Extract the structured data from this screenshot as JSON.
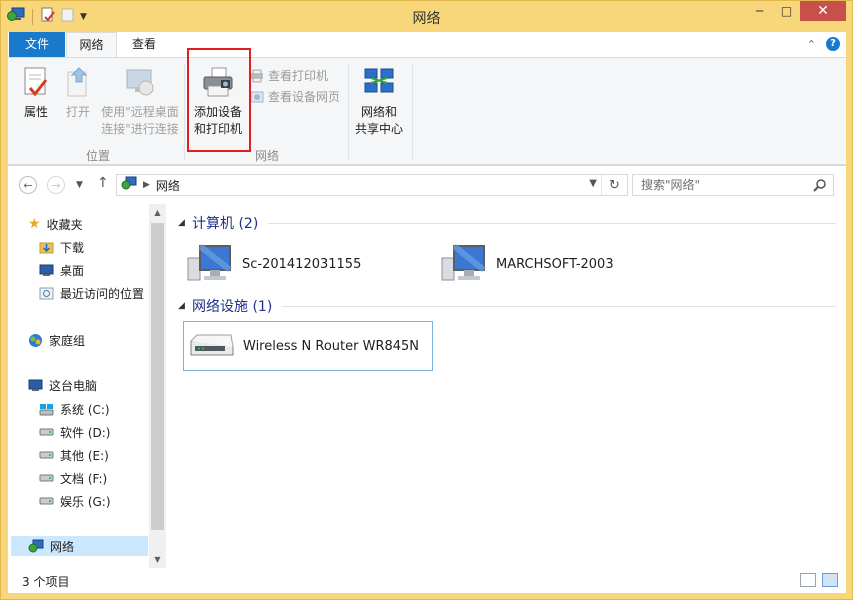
{
  "window": {
    "title": "网络",
    "minimize_glyph": "─",
    "maximize_glyph": "□",
    "close_glyph": "✕"
  },
  "ribbon": {
    "tabs": [
      {
        "label": "文件"
      },
      {
        "label": "网络"
      },
      {
        "label": "查看"
      }
    ],
    "location_group": {
      "label": "位置",
      "properties": "属性",
      "open": "打开",
      "remote_line1": "使用\"远程桌面",
      "remote_line2": "连接\"进行连接"
    },
    "network_group": {
      "label": "网络",
      "add_devices_line1": "添加设备",
      "add_devices_line2": "和打印机",
      "view_printers": "查看打印机",
      "view_device_webpage": "查看设备网页",
      "sharing_center_line1": "网络和",
      "sharing_center_line2": "共享中心"
    }
  },
  "address": {
    "path": "网络",
    "search_placeholder": "搜索\"网络\""
  },
  "nav_pane": {
    "favorites": "收藏夹",
    "downloads": "下载",
    "desktop": "桌面",
    "recent": "最近访问的位置",
    "homegroup": "家庭组",
    "this_pc": "这台电脑",
    "drives": [
      {
        "label": "系统 (C:)"
      },
      {
        "label": "软件 (D:)"
      },
      {
        "label": "其他 (E:)"
      },
      {
        "label": "文档 (F:)"
      },
      {
        "label": "娱乐 (G:)"
      }
    ],
    "network": "网络"
  },
  "content": {
    "computers_header": "计算机 (2)",
    "computers": [
      {
        "name": "Sc-201412031155"
      },
      {
        "name": "MARCHSOFT-2003"
      }
    ],
    "infrastructure_header": "网络设施 (1)",
    "infrastructure": [
      {
        "name": "Wireless N Router WR845N"
      }
    ]
  },
  "status": {
    "count": "3 个项目"
  },
  "colors": {
    "title_bar": "#f7d779",
    "file_tab": "#1979ca",
    "group_header": "#1e3287",
    "highlight": "#e02020"
  }
}
